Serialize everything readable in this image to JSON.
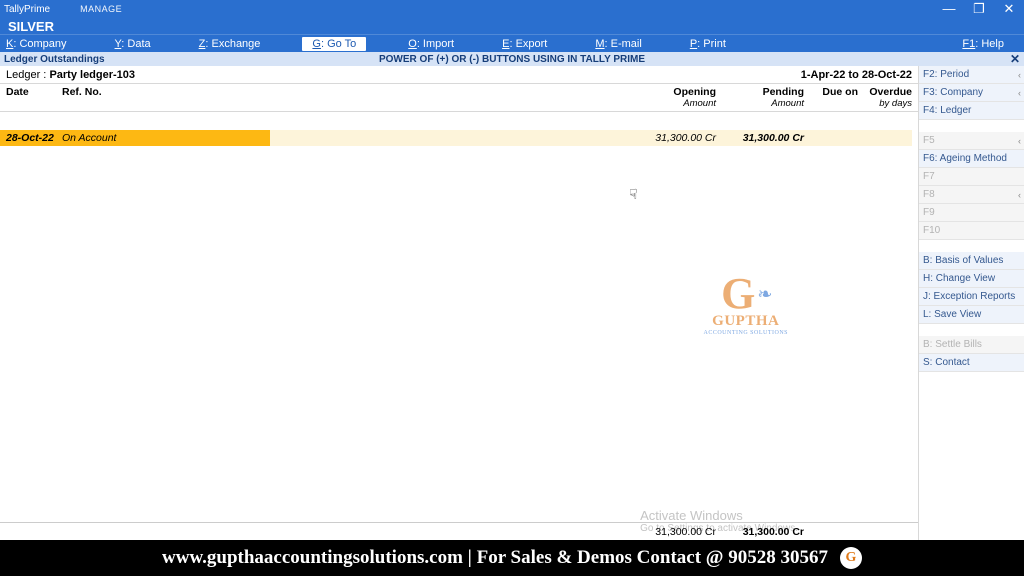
{
  "titlebar": {
    "app": "TallyPrime",
    "manage": "MANAGE",
    "edition": "SILVER"
  },
  "menu": {
    "company": {
      "key": "K",
      "label": ": Company"
    },
    "data": {
      "key": "Y",
      "label": ": Data"
    },
    "exchange": {
      "key": "Z",
      "label": ": Exchange"
    },
    "goto": {
      "key": "G",
      "label": ": Go To"
    },
    "import": {
      "key": "O",
      "label": ": Import"
    },
    "export": {
      "key": "E",
      "label": ": Export"
    },
    "email": {
      "key": "M",
      "label": ": E-mail"
    },
    "print": {
      "key": "P",
      "label": ": Print"
    },
    "help": {
      "key": "F1",
      "label": ": Help"
    }
  },
  "subtitle": {
    "lhs": "Ledger Outstandings",
    "mid": "POWER OF (+) OR (-) BUTTONS USING IN TALLY PRIME"
  },
  "ledger": {
    "label": "Ledger :",
    "name": "Party ledger-103",
    "range": "1-Apr-22 to 28-Oct-22"
  },
  "columns": {
    "date": "Date",
    "ref": "Ref. No.",
    "open": "Opening",
    "open_sub": "Amount",
    "pend": "Pending",
    "pend_sub": "Amount",
    "due": "Due on",
    "over": "Overdue",
    "over_sub": "by days"
  },
  "row": {
    "date": "28-Oct-22",
    "ref": "On Account",
    "open": "31,300.00 Cr",
    "pend": "31,300.00 Cr"
  },
  "totals": {
    "open": "31,300.00 Cr",
    "pend": "31,300.00 Cr"
  },
  "right_panel": {
    "f2": "F2: Period",
    "f3": "F3: Company",
    "f4": "F4: Ledger",
    "f5": "F5",
    "f6": "F6: Ageing Method",
    "f7": "F7",
    "f8": "F8",
    "f9": "F9",
    "f10": "F10",
    "basis": "B: Basis of Values",
    "change": "H: Change View",
    "exception": "J: Exception Reports",
    "save": "L: Save View",
    "settle": "B: Settle Bills",
    "contact": "S: Contact"
  },
  "watermark": {
    "name": "GUPTHA",
    "sub": "ACCOUNTING SOLUTIONS"
  },
  "activate": {
    "title": "Activate Windows",
    "sub": "Go to Settings to activate Windows."
  },
  "banner": "www.gupthaaccountingsolutions.com | For Sales & Demos Contact @ 90528 30567"
}
